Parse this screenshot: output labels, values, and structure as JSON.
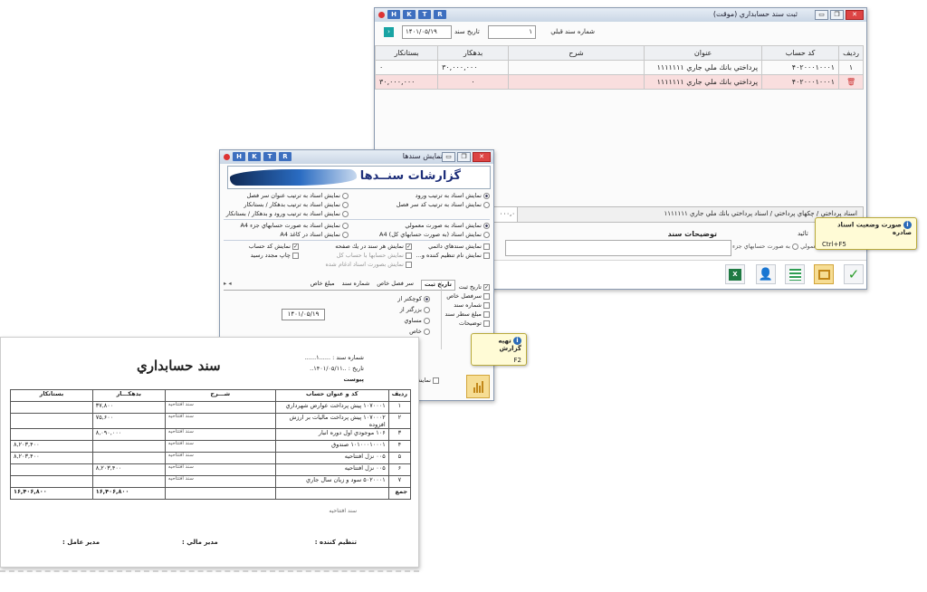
{
  "voucher_window": {
    "title": "ثبت سند حسابداري (موقت)",
    "keys": [
      "H",
      "K",
      "T",
      "R"
    ],
    "prev_doc_label": "شماره سند قبلي",
    "prev_doc_value": "۱",
    "date_label": "تاريخ سند",
    "date_value": "۱۴۰۱/۰۵/۱۹",
    "columns": [
      "رديف",
      "کد حساب",
      "عنوان",
      "شرح",
      "بدهکار",
      "بستانکار"
    ],
    "rows": [
      [
        "۱",
        "۴۰۲۰۰۰۱۰۰۰۱",
        "پرداختي بانك ملي جاري ۱۱۱۱۱۱۱",
        "",
        "۳۰,۰۰۰,۰۰۰",
        "۰"
      ],
      [
        "",
        "۴۰۲۰۰۰۱۰۰۰۱",
        "پرداختي بانك ملي جاري ۱۱۱۱۱۱۱",
        "",
        "۰",
        "۳۰,۰۰۰,۰۰۰"
      ]
    ],
    "desc_text": "اسناد پرداختي / چكهاي پرداختي / اسناد پرداختي بانك ملي جاري ۱۱۱۱۱۱۱",
    "left_value": "۰۰۰,۰",
    "notes_label": "توضيحات سند",
    "confirm_label": "تائيد",
    "normal_label": "معمولي",
    "sub_accounts_label": "به صورت حسابهاي جزء"
  },
  "tooltip_status": {
    "title": "صورت وضعيت اسناد صادره",
    "shortcut": "Ctrl+F5"
  },
  "tooltip_report": {
    "title": "تهيه گزارش",
    "shortcut": "F2"
  },
  "report_window": {
    "title": "نمايش سندها",
    "keys": [
      "H",
      "K",
      "T",
      "R"
    ],
    "banner": "گزارشات سنــدها",
    "sort_options": [
      "نمايش اسناد به ترتيب ورود",
      "نمايش اسناد به ترتيب کد سر فصل",
      "نمايش اسناد به ترتيب عنوان سر فصل",
      "نمايش اسناد به ترتيب بدهکار / بستانکار",
      "نمايش اسناد به ترتيب ورود و بدهکار / بستانکار"
    ],
    "layout_options": [
      "نمايش اسناد به صورت معمولي",
      "نمايش اسناد (به صورت حسابهاي کل) A4",
      "نمايش اسناد به صورت حسابهاي جزء A4",
      "نمايش اسناد در کاغذ A4"
    ],
    "check_options": [
      "نمايش سندهاي دائمي",
      "نمايش هر سند در يك صفحه",
      "نمايش کد حساب",
      "نمايش نام تنظيم کننده و...",
      "نمايش حسابها با حساب کل",
      "چاپ مجدد رسيد",
      "نمايش بصورت اسناد ادغام شده"
    ],
    "tabs": [
      "تاريخ ثبت",
      "سر فصل خاص",
      "شماره سند",
      "مبلغ خاص"
    ],
    "compare_options": [
      "کوچکتر از",
      "بزرگتر از",
      "مساوي",
      "خاص"
    ],
    "date_value": "۱۴۰۱/۰۵/۱۹",
    "filters": [
      "تاريخ ثبت",
      "سرفصل خاص",
      "شماره سند",
      "مبلغ سطر سند",
      "توضيحات"
    ],
    "show_label": "نمايش"
  },
  "printed_doc": {
    "title": "سند حسابداري",
    "doc_no_label": "شماره سند",
    "doc_no": "۱",
    "date_label": "تاريخ",
    "date": "۱۴۰۱/۰۵/۱۱",
    "attach_label": "پيوست",
    "columns": [
      "رديف",
      "کد و عنوان حساب",
      "شـــرح",
      "بدهکـــار",
      "بستانکار"
    ],
    "rows": [
      [
        "۱",
        "۱۰۷۰۰۰۱ پيش پرداخت عوارض شهرداري",
        "سند افتتاحيه",
        "۳۷,۸۰۰",
        ""
      ],
      [
        "۲",
        "۱۰۷۰۰۰۲ پيش پرداخت ماليات بر ارزش افزوده",
        "سند افتتاحيه",
        "۷۵,۶۰۰",
        ""
      ],
      [
        "۳",
        "۱۰۶ موجودي اول دوره انبار",
        "سند افتتاحيه",
        "۸,۰۹۰,۰۰۰",
        ""
      ],
      [
        "۴",
        "۱۰۱۰۰۰۱۰۰۰۱ صندوق",
        "سند افتتاحيه",
        "",
        "۸,۲۰۳,۴۰۰"
      ],
      [
        "۵",
        "۰۰۵ نزل افتتاحيه",
        "سند افتتاحيه",
        "",
        "۸,۲۰۳,۴۰۰"
      ],
      [
        "۶",
        "۰۰۵ نزل افتتاحيه",
        "سند افتتاحيه",
        "۸,۲۰۳,۴۰۰",
        ""
      ],
      [
        "۷",
        "۵۰۲۰۰۰۱ سود و زيان سال جاري",
        "سند افتتاحيه",
        "",
        ""
      ]
    ],
    "total_label": "جمع",
    "total_debit": "۱۶,۴۰۶,۸۰۰",
    "total_credit": "۱۶,۴۰۶,۸۰۰",
    "footnote": "سند افتتاحيه",
    "sign_preparer": "تنظيم کننده :",
    "sign_finance": "مدير مالي :",
    "sign_ceo": "مدير عامل :"
  }
}
